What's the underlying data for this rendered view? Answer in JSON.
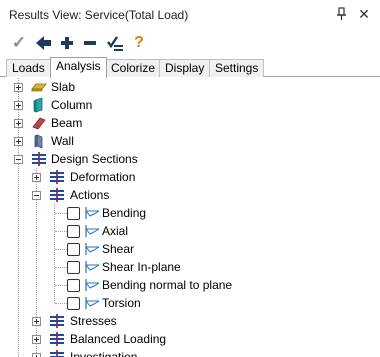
{
  "window": {
    "title": "Results View: Service(Total Load)",
    "pin_glyph": "📌",
    "close_glyph": "✕"
  },
  "toolbar": {
    "check_glyph": "✓",
    "help_glyph": "?"
  },
  "tabs": [
    {
      "label": "Loads"
    },
    {
      "label": "Analysis"
    },
    {
      "label": "Colorize"
    },
    {
      "label": "Display"
    },
    {
      "label": "Settings"
    }
  ],
  "tree": {
    "slab": "Slab",
    "column": "Column",
    "beam": "Beam",
    "wall": "Wall",
    "design_sections": "Design Sections",
    "deformation": "Deformation",
    "actions": "Actions",
    "action_items": [
      {
        "label": "Bending"
      },
      {
        "label": "Axial"
      },
      {
        "label": "Shear"
      },
      {
        "label": "Shear In-plane"
      },
      {
        "label": "Bending normal to plane"
      },
      {
        "label": "Torsion"
      }
    ],
    "stresses": "Stresses",
    "balanced_loading": "Balanced Loading",
    "investigation": "Investigation"
  },
  "colors": {
    "check": "#8f8f8f",
    "arrow": "#1f3b5c",
    "help": "#e07a1f",
    "slab": "#d9b62b",
    "column": "#2aa6a6",
    "beam": "#b5484b",
    "wall": "#6f86a8",
    "section_red": "#d0312d",
    "section_blue": "#1f4aa0"
  }
}
